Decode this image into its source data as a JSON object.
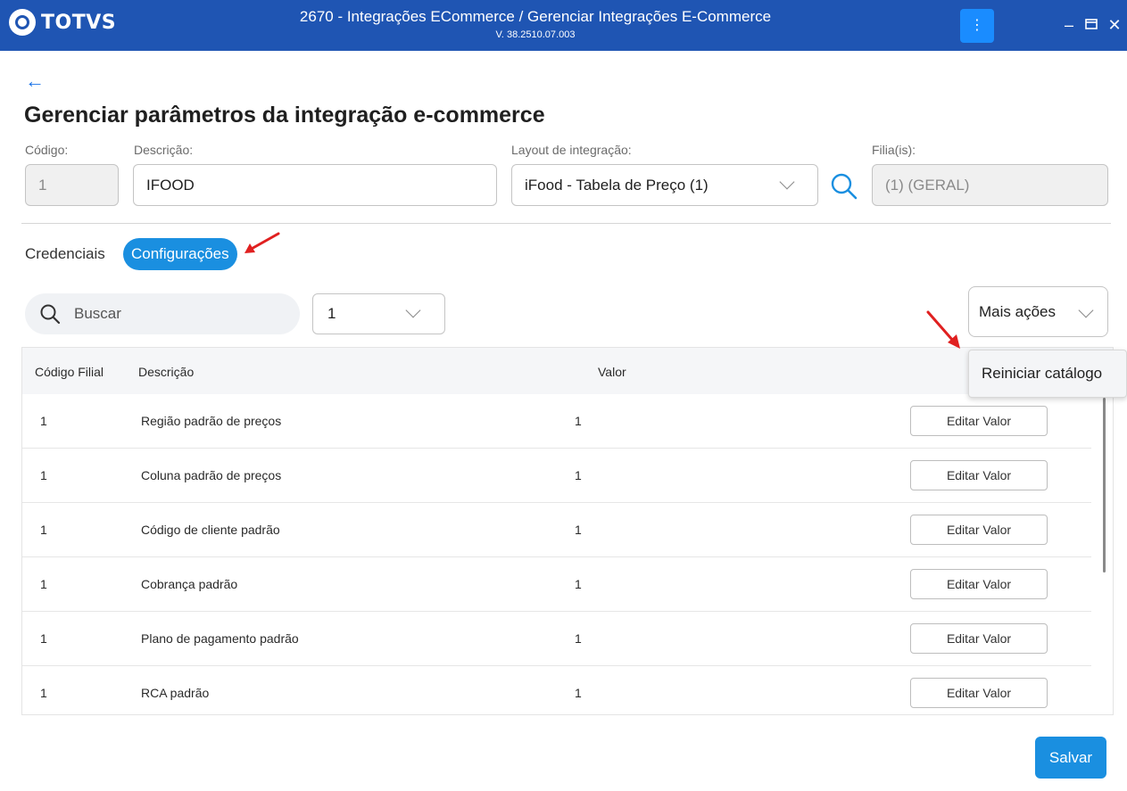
{
  "window": {
    "brand": "TOTVS",
    "title": "2670 - Integrações ECommerce / Gerenciar Integrações E-Commerce",
    "version": "V. 38.2510.07.003",
    "menu_icon": "kebab-icon",
    "minimize_icon": "minimize-icon",
    "maximize_icon": "maximize-icon",
    "close_icon": "close-icon"
  },
  "page": {
    "back_icon": "arrow-left-icon",
    "heading": "Gerenciar parâmetros da integração e-commerce"
  },
  "form": {
    "codigo": {
      "label": "Código:",
      "value": "1"
    },
    "descricao": {
      "label": "Descrição:",
      "value": "IFOOD"
    },
    "layout": {
      "label": "Layout de integração:",
      "value": "iFood - Tabela de Preço (1)"
    },
    "filiais": {
      "label": "Filia(is):",
      "value": "(1) (GERAL)"
    }
  },
  "tabs": [
    {
      "label": "Credenciais",
      "active": false
    },
    {
      "label": "Configurações",
      "active": true
    }
  ],
  "toolbar": {
    "search_placeholder": "Buscar",
    "filter_value": "1",
    "more_actions_label": "Mais ações",
    "more_actions_menu": [
      "Reiniciar catálogo"
    ]
  },
  "table": {
    "columns": [
      "Código Filial",
      "Descrição",
      "Valor"
    ],
    "action_label": "Editar Valor",
    "rows": [
      {
        "codigo": "1",
        "descricao": "Região padrão de preços",
        "valor": "1"
      },
      {
        "codigo": "1",
        "descricao": "Coluna padrão de preços",
        "valor": "1"
      },
      {
        "codigo": "1",
        "descricao": "Código de cliente padrão",
        "valor": "1"
      },
      {
        "codigo": "1",
        "descricao": "Cobrança padrão",
        "valor": "1"
      },
      {
        "codigo": "1",
        "descricao": "Plano de pagamento padrão",
        "valor": "1"
      },
      {
        "codigo": "1",
        "descricao": "RCA padrão",
        "valor": "1"
      }
    ]
  },
  "footer": {
    "save_label": "Salvar"
  },
  "colors": {
    "titlebar": "#1f55b3",
    "accent": "#1a8fe0",
    "annotation_arrow": "#e02020"
  }
}
